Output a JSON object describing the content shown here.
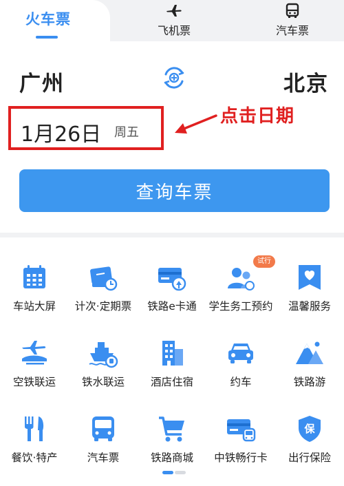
{
  "tabs": {
    "train": "火车票",
    "flight": "飞机票",
    "bus": "汽车票"
  },
  "trip": {
    "from": "广州",
    "to": "北京",
    "date": "1月26日",
    "weekday": "周五"
  },
  "annotation": "点击日期",
  "search_button": "查询车票",
  "services": [
    {
      "label": "车站大屏",
      "icon": "station-screen-icon"
    },
    {
      "label": "计次·定期票",
      "icon": "ticket-clock-icon"
    },
    {
      "label": "铁路e卡通",
      "icon": "rail-card-icon"
    },
    {
      "label": "学生务工预约",
      "icon": "people-icon"
    },
    {
      "label": "温馨服务",
      "icon": "heart-service-icon"
    },
    {
      "label": "空铁联运",
      "icon": "air-rail-icon"
    },
    {
      "label": "铁水联运",
      "icon": "ship-rail-icon"
    },
    {
      "label": "酒店住宿",
      "icon": "hotel-icon"
    },
    {
      "label": "约车",
      "icon": "car-icon"
    },
    {
      "label": "铁路游",
      "icon": "mountain-icon"
    },
    {
      "label": "餐饮·特产",
      "icon": "fork-knife-icon"
    },
    {
      "label": "汽车票",
      "icon": "bus-icon"
    },
    {
      "label": "铁路商城",
      "icon": "cart-icon"
    },
    {
      "label": "中铁畅行卡",
      "icon": "train-card-icon"
    },
    {
      "label": "出行保险",
      "icon": "insurance-shield-icon"
    }
  ],
  "badge": "试行",
  "colors": {
    "accent": "#3a8ef0",
    "highlight": "#e02020",
    "button": "#3d97ef"
  }
}
